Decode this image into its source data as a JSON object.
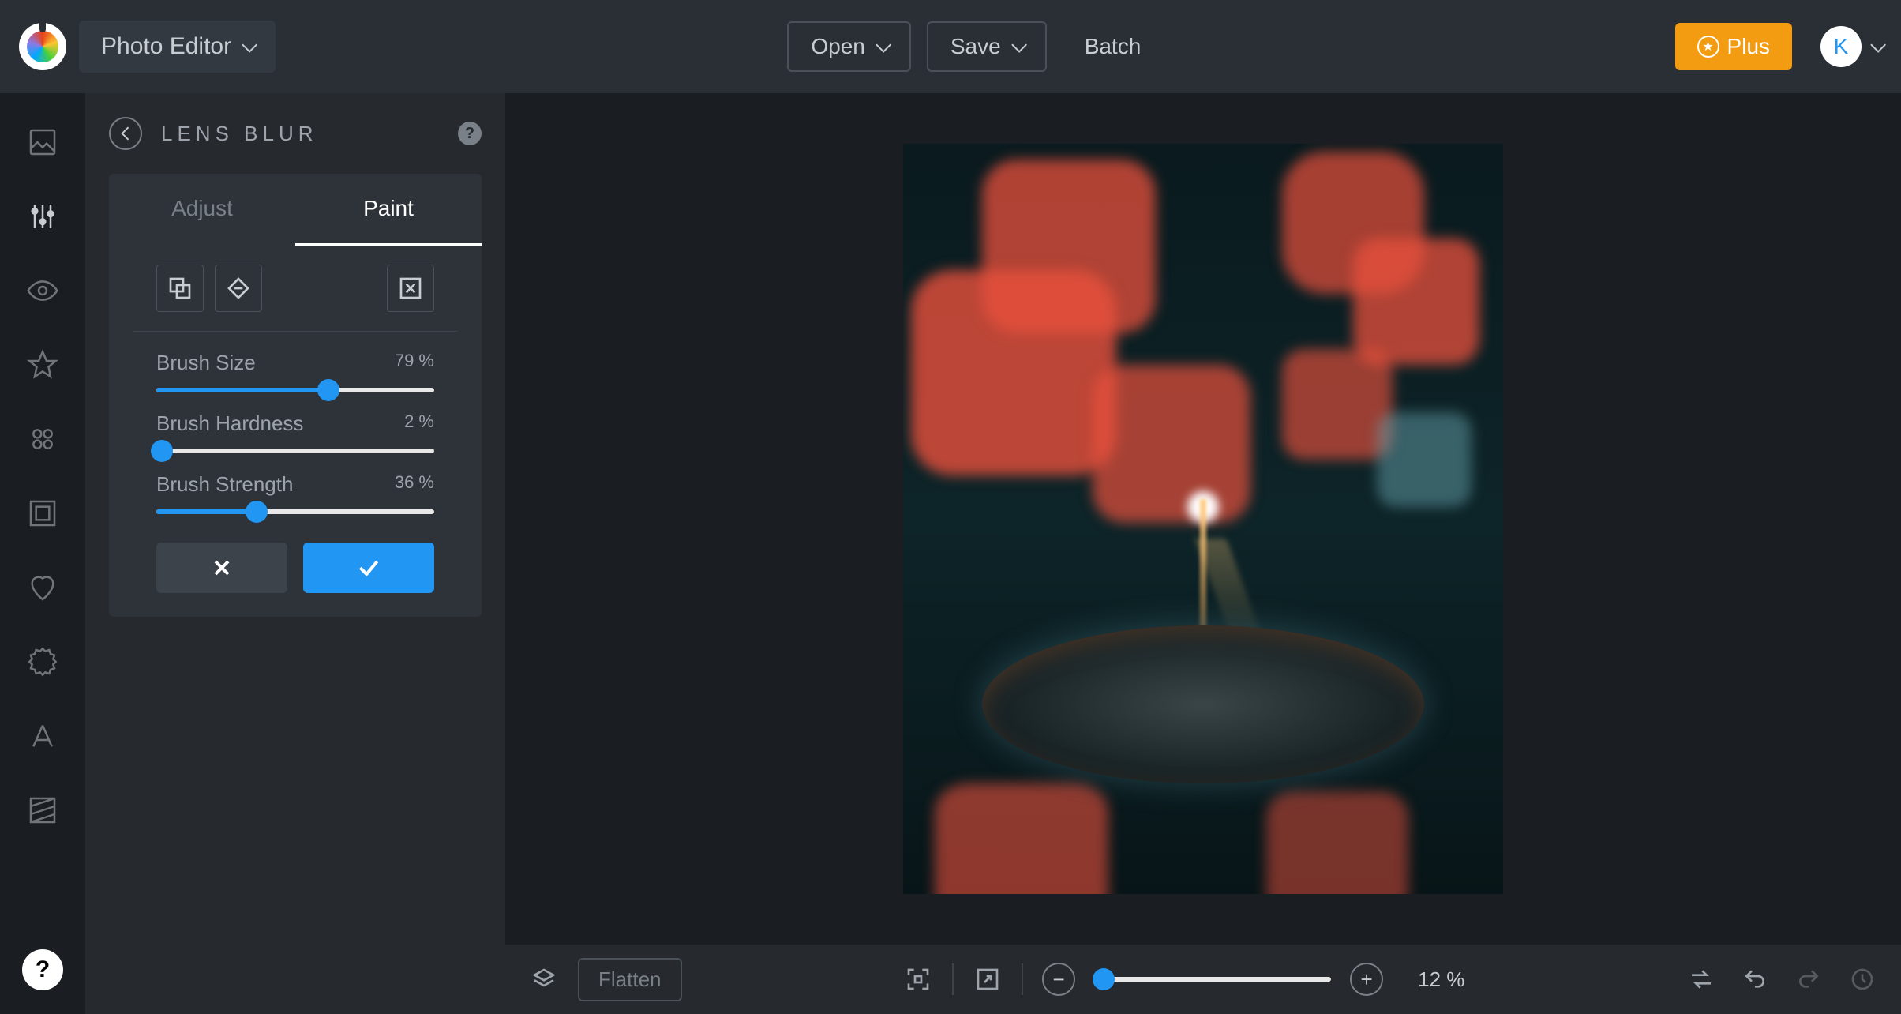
{
  "topbar": {
    "app_title": "Photo Editor",
    "open_label": "Open",
    "save_label": "Save",
    "batch_label": "Batch",
    "plus_label": "Plus",
    "avatar_letter": "K"
  },
  "panel": {
    "title": "LENS BLUR",
    "tabs": {
      "adjust": "Adjust",
      "paint": "Paint"
    },
    "sliders": {
      "brush_size": {
        "label": "Brush Size",
        "value": "79 %",
        "percent": 62
      },
      "brush_hardness": {
        "label": "Brush Hardness",
        "value": "2 %",
        "percent": 2
      },
      "brush_strength": {
        "label": "Brush Strength",
        "value": "36 %",
        "percent": 36
      }
    }
  },
  "bottombar": {
    "flatten_label": "Flatten",
    "zoom_text": "12 %",
    "zoom_percent": 4
  }
}
